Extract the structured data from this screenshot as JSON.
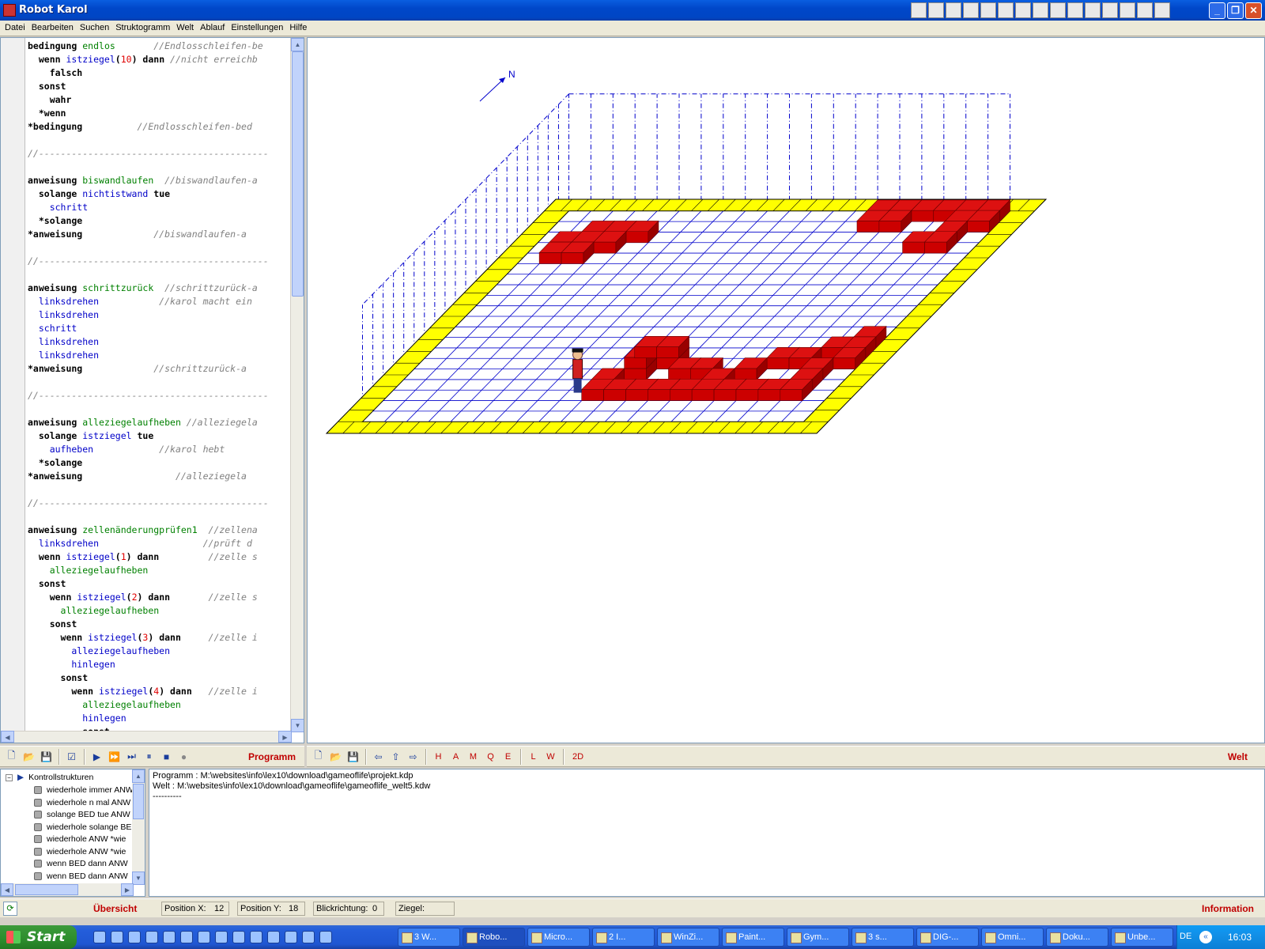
{
  "window": {
    "title": "Robot Karol",
    "tray_icons": [
      "toolbar-icon",
      "toolbar-icon",
      "toolbar-icon",
      "mail-icon",
      "toolbar-icon",
      "toolbar-icon",
      "toolbar-icon",
      "toolbar-icon",
      "toolbar-icon",
      "word-icon",
      "excel-icon",
      "powerpoint-icon",
      "toolbar-icon",
      "toolbar-icon",
      "toolbar-icon"
    ]
  },
  "menu": [
    "Datei",
    "Bearbeiten",
    "Suchen",
    "Struktogramm",
    "Welt",
    "Ablauf",
    "Einstellungen",
    "Hilfe"
  ],
  "code": {
    "lines": [
      [
        [
          "kw",
          "bedingung "
        ],
        [
          "gr",
          "endlos"
        ],
        [
          "cm",
          "       //Endlosschleifen-be"
        ]
      ],
      [
        [
          "kw",
          "  wenn "
        ],
        [
          "cl",
          "istziegel"
        ],
        [
          "kw",
          "("
        ],
        [
          "nm",
          "10"
        ],
        [
          "kw",
          ") dann "
        ],
        [
          "cm",
          "//nicht erreichb"
        ]
      ],
      [
        [
          "kw",
          "    falsch"
        ]
      ],
      [
        [
          "kw",
          "  sonst"
        ]
      ],
      [
        [
          "kw",
          "    wahr"
        ]
      ],
      [
        [
          "kw",
          "  *wenn"
        ]
      ],
      [
        [
          "kw",
          "*bedingung"
        ],
        [
          "cm",
          "          //Endlosschleifen-bed"
        ]
      ],
      [],
      [
        [
          "cm",
          "//------------------------------------------"
        ]
      ],
      [],
      [
        [
          "kw",
          "anweisung "
        ],
        [
          "gr",
          "biswandlaufen"
        ],
        [
          "cm",
          "  //biswandlaufen-a"
        ]
      ],
      [
        [
          "kw",
          "  solange "
        ],
        [
          "cl",
          "nichtistwand"
        ],
        [
          "kw",
          " tue"
        ]
      ],
      [
        [
          "cl",
          "    schritt"
        ]
      ],
      [
        [
          "kw",
          "  *solange"
        ]
      ],
      [
        [
          "kw",
          "*anweisung"
        ],
        [
          "cm",
          "             //biswandlaufen-a"
        ]
      ],
      [],
      [
        [
          "cm",
          "//------------------------------------------"
        ]
      ],
      [],
      [
        [
          "kw",
          "anweisung "
        ],
        [
          "gr",
          "schrittzurück"
        ],
        [
          "cm",
          "  //schrittzurück-a"
        ]
      ],
      [
        [
          "cl",
          "  linksdrehen"
        ],
        [
          "cm",
          "           //karol macht ein"
        ]
      ],
      [
        [
          "cl",
          "  linksdrehen"
        ]
      ],
      [
        [
          "cl",
          "  schritt"
        ]
      ],
      [
        [
          "cl",
          "  linksdrehen"
        ]
      ],
      [
        [
          "cl",
          "  linksdrehen"
        ]
      ],
      [
        [
          "kw",
          "*anweisung"
        ],
        [
          "cm",
          "             //schrittzurück-a"
        ]
      ],
      [],
      [
        [
          "cm",
          "//------------------------------------------"
        ]
      ],
      [],
      [
        [
          "kw",
          "anweisung "
        ],
        [
          "gr",
          "alleziegelaufheben"
        ],
        [
          "cm",
          " //alleziegela"
        ]
      ],
      [
        [
          "kw",
          "  solange "
        ],
        [
          "cl",
          "istziegel"
        ],
        [
          "kw",
          " tue"
        ]
      ],
      [
        [
          "cl",
          "    aufheben"
        ],
        [
          "cm",
          "            //karol hebt"
        ]
      ],
      [
        [
          "kw",
          "  *solange"
        ]
      ],
      [
        [
          "kw",
          "*anweisung"
        ],
        [
          "cm",
          "                 //alleziegela"
        ]
      ],
      [],
      [
        [
          "cm",
          "//------------------------------------------"
        ]
      ],
      [],
      [
        [
          "kw",
          "anweisung "
        ],
        [
          "gr",
          "zellenänderungprüfen1"
        ],
        [
          "cm",
          "  //zellena"
        ]
      ],
      [
        [
          "cl",
          "  linksdrehen"
        ],
        [
          "cm",
          "                   //prüft d"
        ]
      ],
      [
        [
          "kw",
          "  wenn "
        ],
        [
          "cl",
          "istziegel"
        ],
        [
          "kw",
          "("
        ],
        [
          "nm",
          "1"
        ],
        [
          "kw",
          ") dann"
        ],
        [
          "cm",
          "         //zelle s"
        ]
      ],
      [
        [
          "gr",
          "    alleziegelaufheben"
        ]
      ],
      [
        [
          "kw",
          "  sonst"
        ]
      ],
      [
        [
          "kw",
          "    wenn "
        ],
        [
          "cl",
          "istziegel"
        ],
        [
          "kw",
          "("
        ],
        [
          "nm",
          "2"
        ],
        [
          "kw",
          ") dann"
        ],
        [
          "cm",
          "       //zelle s"
        ]
      ],
      [
        [
          "gr",
          "      alleziegelaufheben"
        ]
      ],
      [
        [
          "kw",
          "    sonst"
        ]
      ],
      [
        [
          "kw",
          "      wenn "
        ],
        [
          "cl",
          "istziegel"
        ],
        [
          "kw",
          "("
        ],
        [
          "nm",
          "3"
        ],
        [
          "kw",
          ") dann"
        ],
        [
          "cm",
          "     //zelle i"
        ]
      ],
      [
        [
          "cl",
          "        alleziegelaufheben"
        ]
      ],
      [
        [
          "cl",
          "        hinlegen"
        ]
      ],
      [
        [
          "kw",
          "      sonst"
        ]
      ],
      [
        [
          "kw",
          "        wenn "
        ],
        [
          "cl",
          "istziegel"
        ],
        [
          "kw",
          "("
        ],
        [
          "nm",
          "4"
        ],
        [
          "kw",
          ") dann"
        ],
        [
          "cm",
          "   //zelle i"
        ]
      ],
      [
        [
          "gr",
          "          alleziegelaufheben"
        ]
      ],
      [
        [
          "cl",
          "          hinlegen"
        ]
      ],
      [
        [
          "kw",
          "          sonst"
        ]
      ]
    ]
  },
  "world": {
    "compass_label": "N",
    "grid_cols": 20,
    "grid_rows": 20,
    "floor_color": "#ffff00",
    "brick_color": "#cc0000",
    "wall_line_color": "#0000cc",
    "robot": {
      "x": 12,
      "y": 18
    }
  },
  "toolbar_left": {
    "title": "Programm",
    "icons": [
      "new-file-icon",
      "open-folder-icon",
      "save-icon",
      "check-icon",
      "play-icon",
      "fast-forward-icon",
      "step-icon",
      "pause-icon",
      "stop-icon",
      "record-icon"
    ]
  },
  "toolbar_right": {
    "title": "Welt",
    "letters": [
      "H",
      "A",
      "M",
      "Q",
      "E",
      "L",
      "W",
      "2D"
    ]
  },
  "tree": {
    "root": "Kontrollstrukturen",
    "items": [
      "wiederhole immer ANW",
      "wiederhole n mal ANW",
      "solange BED tue ANW",
      "wiederhole solange BE",
      "wiederhole ANW *wie",
      "wiederhole ANW *wie",
      "wenn BED dann ANW",
      "wenn BED dann ANW"
    ]
  },
  "messages": [
    "Programm : M:\\websites\\info\\lex10\\download\\gameoflife\\projekt.kdp",
    "Welt : M:\\websites\\info\\lex10\\download\\gameoflife\\gameoflife_welt5.kdw",
    "----------"
  ],
  "status": {
    "overview": "Übersicht",
    "pos_x_label": "Position X:",
    "pos_x": "12",
    "pos_y_label": "Position Y:",
    "pos_y": "18",
    "direction_label": "Blickrichtung:",
    "direction": "0",
    "bricks_label": "Ziegel:",
    "info": "Information"
  },
  "taskbar": {
    "start": "Start",
    "items": [
      "3 W...",
      "Robo...",
      "Micro...",
      "2 I...",
      "WinZi...",
      "Paint...",
      "Gym...",
      "3 s...",
      "DIG-...",
      "Omni...",
      "Doku...",
      "Unbe..."
    ],
    "active_index": 1,
    "lang": "DE",
    "clock": "16:03"
  }
}
